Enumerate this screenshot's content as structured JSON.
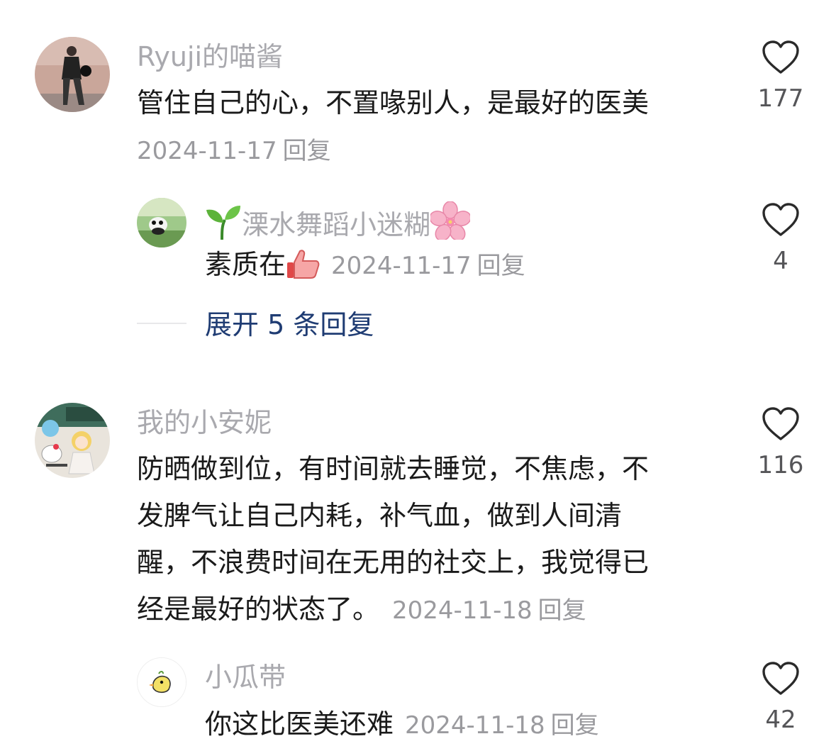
{
  "comments": [
    {
      "author": "Ryuji的喵酱",
      "text": "管住自己的心，不置喙别人，是最好的医美",
      "date": "2024-11-17",
      "reply_label": "回复",
      "likes": "177",
      "replies": [
        {
          "author_prefix_icon": "seedling-emoji",
          "author": "溧水舞蹈小迷糊",
          "author_suffix_icon": "cherry-blossom-emoji",
          "text": "素质在",
          "text_suffix_icon": "thumbs-up-emoji",
          "date": "2024-11-17",
          "reply_label": "回复",
          "likes": "4"
        }
      ],
      "expand_label": "展开 5 条回复"
    },
    {
      "author": "我的小安妮",
      "text_lines": [
        "防晒做到位，有时间就去睡觉，不焦虑，不",
        "发脾气让自己内耗，补气血，做到人间清",
        "醒，不浪费时间在无用的社交上，我觉得已",
        "经是最好的状态了。"
      ],
      "date": "2024-11-18",
      "reply_label": "回复",
      "likes": "116",
      "replies": [
        {
          "author": "小瓜带",
          "text": "你这比医美还难",
          "date": "2024-11-18",
          "reply_label": "回复",
          "likes": "42"
        }
      ]
    }
  ],
  "icons": {
    "like": "heart-outline-icon"
  },
  "colors": {
    "author_name": "#a9a9ae",
    "body_text": "#1a1a1a",
    "meta_text": "#9a9a9e",
    "expand_link": "#1f3c73",
    "like_icon": "#2a2a2a"
  }
}
